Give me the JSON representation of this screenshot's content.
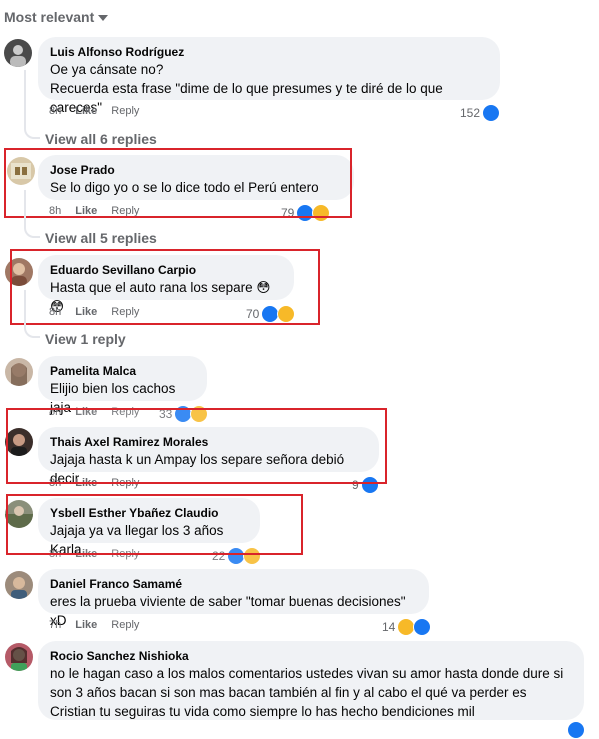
{
  "sort_label": "Most relevant",
  "comments": [
    {
      "author": "Luis Alfonso Rodríguez",
      "text": "Oe ya cánsate no?\nRecuerda esta frase \"dime de lo que presumes y te diré de lo que careces\"",
      "time": "8h",
      "like": "Like",
      "reply": "Reply",
      "count": "152",
      "reactions": [
        "like"
      ]
    },
    {
      "author": "Jose Prado",
      "text": "Se lo digo yo o se lo dice todo el Perú entero",
      "time": "8h",
      "like": "Like",
      "reply": "Reply",
      "count": "79",
      "reactions": [
        "like",
        "haha"
      ]
    },
    {
      "author": "Eduardo Sevillano Carpio",
      "text": "Hasta que el auto rana los separe 😳😳",
      "time": "8h",
      "like": "Like",
      "reply": "Reply",
      "count": "70",
      "reactions": [
        "like",
        "haha"
      ]
    },
    {
      "author": "Pamelita Malca",
      "text": "Elijio bien los cachos jaja",
      "time": "8h",
      "like": "Like",
      "reply": "Reply",
      "count": "33",
      "reactions": [
        "like",
        "haha"
      ]
    },
    {
      "author": "Thais Axel Ramirez Morales",
      "text": "Jajaja hasta k un Ampay los separe señora debió decir",
      "time": "8h",
      "like": "Like",
      "reply": "Reply",
      "count": "9",
      "reactions": [
        "like"
      ]
    },
    {
      "author": "Ysbell Esther Ybañez Claudio",
      "text": "Jajaja ya va llegar los 3 años Karla",
      "time": "8h",
      "like": "Like",
      "reply": "Reply",
      "count": "22",
      "reactions": [
        "like",
        "haha"
      ]
    },
    {
      "author": "Daniel Franco Samamé",
      "text": "eres la prueba viviente de saber \"tomar buenas decisiones\" xD",
      "time": "7h",
      "like": "Like",
      "reply": "Reply",
      "count": "14",
      "reactions": [
        "haha",
        "like"
      ]
    },
    {
      "author": "Rocio Sanchez Nishioka",
      "text": "no le hagan caso a los malos comentarios ustedes vivan su amor hasta donde dure si son 3 años bacan si son mas bacan también al fin y al cabo el qué va perder es Cristian tu seguiras tu vida como siempre lo has hecho bendiciones mil",
      "time": "",
      "like": "",
      "reply": "",
      "count": "",
      "reactions": [
        "like"
      ]
    }
  ],
  "view_replies": [
    "View all 6 replies",
    "View all 5 replies",
    "View 1 reply"
  ],
  "colors": {
    "highlight": "#d9242b",
    "bubble": "#f0f2f5",
    "like": "#1877f2",
    "haha": "#f7b928"
  }
}
